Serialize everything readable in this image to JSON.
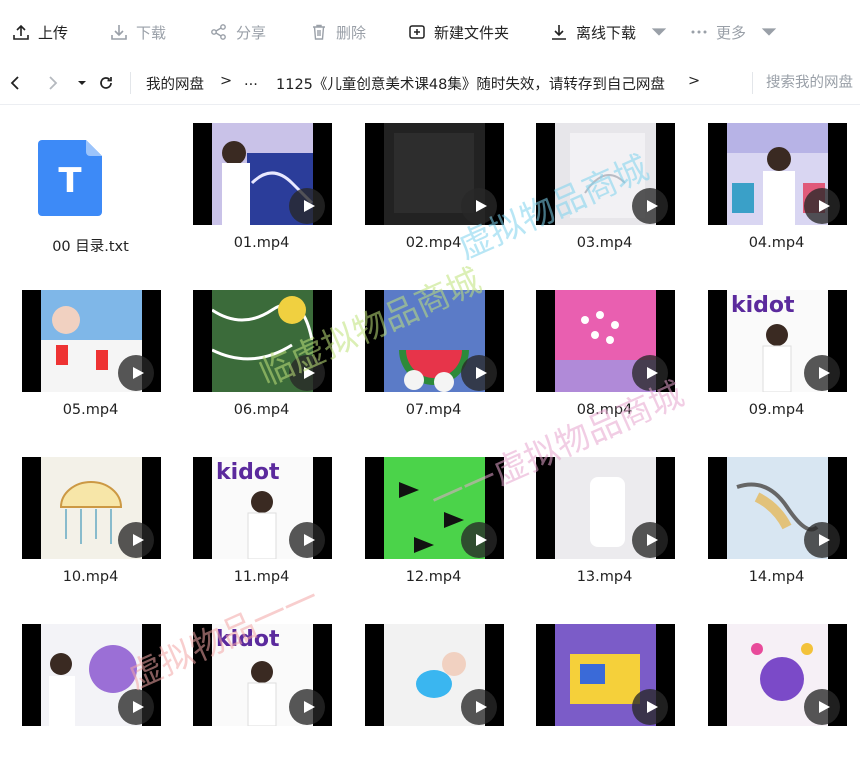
{
  "toolbar": {
    "upload": "上传",
    "download": "下载",
    "share": "分享",
    "delete": "删除",
    "new_folder": "新建文件夹",
    "offline_download": "离线下载",
    "more": "更多"
  },
  "nav": {
    "breadcrumb_root": "我的网盘",
    "breadcrumb_sep": ">",
    "breadcrumb_ellipsis": "...",
    "breadcrumb_current": "1125《儿童创意美术课48集》随时失效，请转存到自己网盘",
    "search_placeholder": "搜索我的网盘"
  },
  "files": [
    {
      "name": "00 目录.txt",
      "type": "txt",
      "icon": "text-file-icon"
    },
    {
      "name": "01.mp4",
      "type": "video"
    },
    {
      "name": "02.mp4",
      "type": "video"
    },
    {
      "name": "03.mp4",
      "type": "video"
    },
    {
      "name": "04.mp4",
      "type": "video"
    },
    {
      "name": "05.mp4",
      "type": "video"
    },
    {
      "name": "06.mp4",
      "type": "video"
    },
    {
      "name": "07.mp4",
      "type": "video"
    },
    {
      "name": "08.mp4",
      "type": "video"
    },
    {
      "name": "09.mp4",
      "type": "video"
    },
    {
      "name": "10.mp4",
      "type": "video"
    },
    {
      "name": "11.mp4",
      "type": "video"
    },
    {
      "name": "12.mp4",
      "type": "video"
    },
    {
      "name": "13.mp4",
      "type": "video"
    },
    {
      "name": "14.mp4",
      "type": "video"
    },
    {
      "name": "",
      "type": "video"
    },
    {
      "name": "",
      "type": "video"
    },
    {
      "name": "",
      "type": "video"
    },
    {
      "name": "",
      "type": "video"
    },
    {
      "name": "",
      "type": "video"
    }
  ],
  "txt_icon_letter": "T",
  "watermarks": [
    "虚拟物品商城",
    "临虚拟物品商城",
    "一一虚拟物品商城",
    "虚拟物品一一"
  ],
  "colors": {
    "accent": "#3d8af7",
    "thumb_bg": "#000000"
  }
}
